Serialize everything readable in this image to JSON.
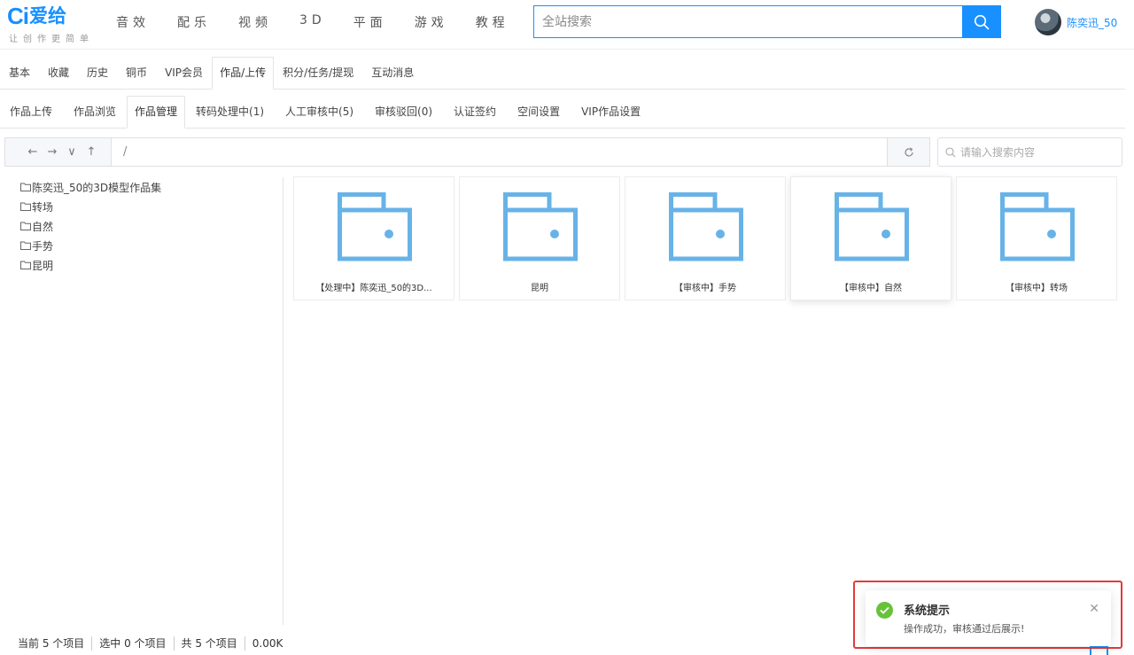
{
  "brand": {
    "logo_mark": "Ci",
    "logo_text": "爱给",
    "slogan": "让创作更简单"
  },
  "nav": [
    "音效",
    "配乐",
    "视频",
    "3D",
    "平面",
    "游戏",
    "教程"
  ],
  "search": {
    "placeholder": "全站搜索",
    "icon": "search-icon",
    "button_color": "#1890ff"
  },
  "user": {
    "name": "陈奕迅_50"
  },
  "account_tabs": [
    "基本",
    "收藏",
    "历史",
    "铜币",
    "VIP会员",
    "作品/上传",
    "积分/任务/提现",
    "互动消息"
  ],
  "account_tab_active": "作品/上传",
  "work_tabs": [
    "作品上传",
    "作品浏览",
    "作品管理",
    "转码处理中(1)",
    "人工审核中(5)",
    "审核驳回(0)",
    "认证签约",
    "空间设置",
    "VIP作品设置"
  ],
  "work_tab_active": "作品管理",
  "file_manager": {
    "path": "/",
    "search_placeholder": "请输入搜索内容",
    "nav_arrows": [
      "←",
      "→",
      "∨",
      "↑"
    ],
    "tree": [
      "陈奕迅_50的3D模型作品集",
      "转场",
      "自然",
      "手势",
      "昆明"
    ],
    "folders": [
      "【处理中】陈奕迅_50的3D...",
      "昆明",
      "【审核中】手势",
      "【审核中】自然",
      "【审核中】转场"
    ],
    "folder_color": "#67b3e8",
    "status": {
      "current": "当前 5 个项目",
      "selected": "选中 0 个项目",
      "total": "共 5 个项目",
      "size": "0.00K"
    }
  },
  "notification": {
    "title": "系统提示",
    "message": "操作成功，审核通过后展示!",
    "icon": "check-circle-icon",
    "icon_color": "#67c23a",
    "highlight_color": "#e23a3a"
  }
}
